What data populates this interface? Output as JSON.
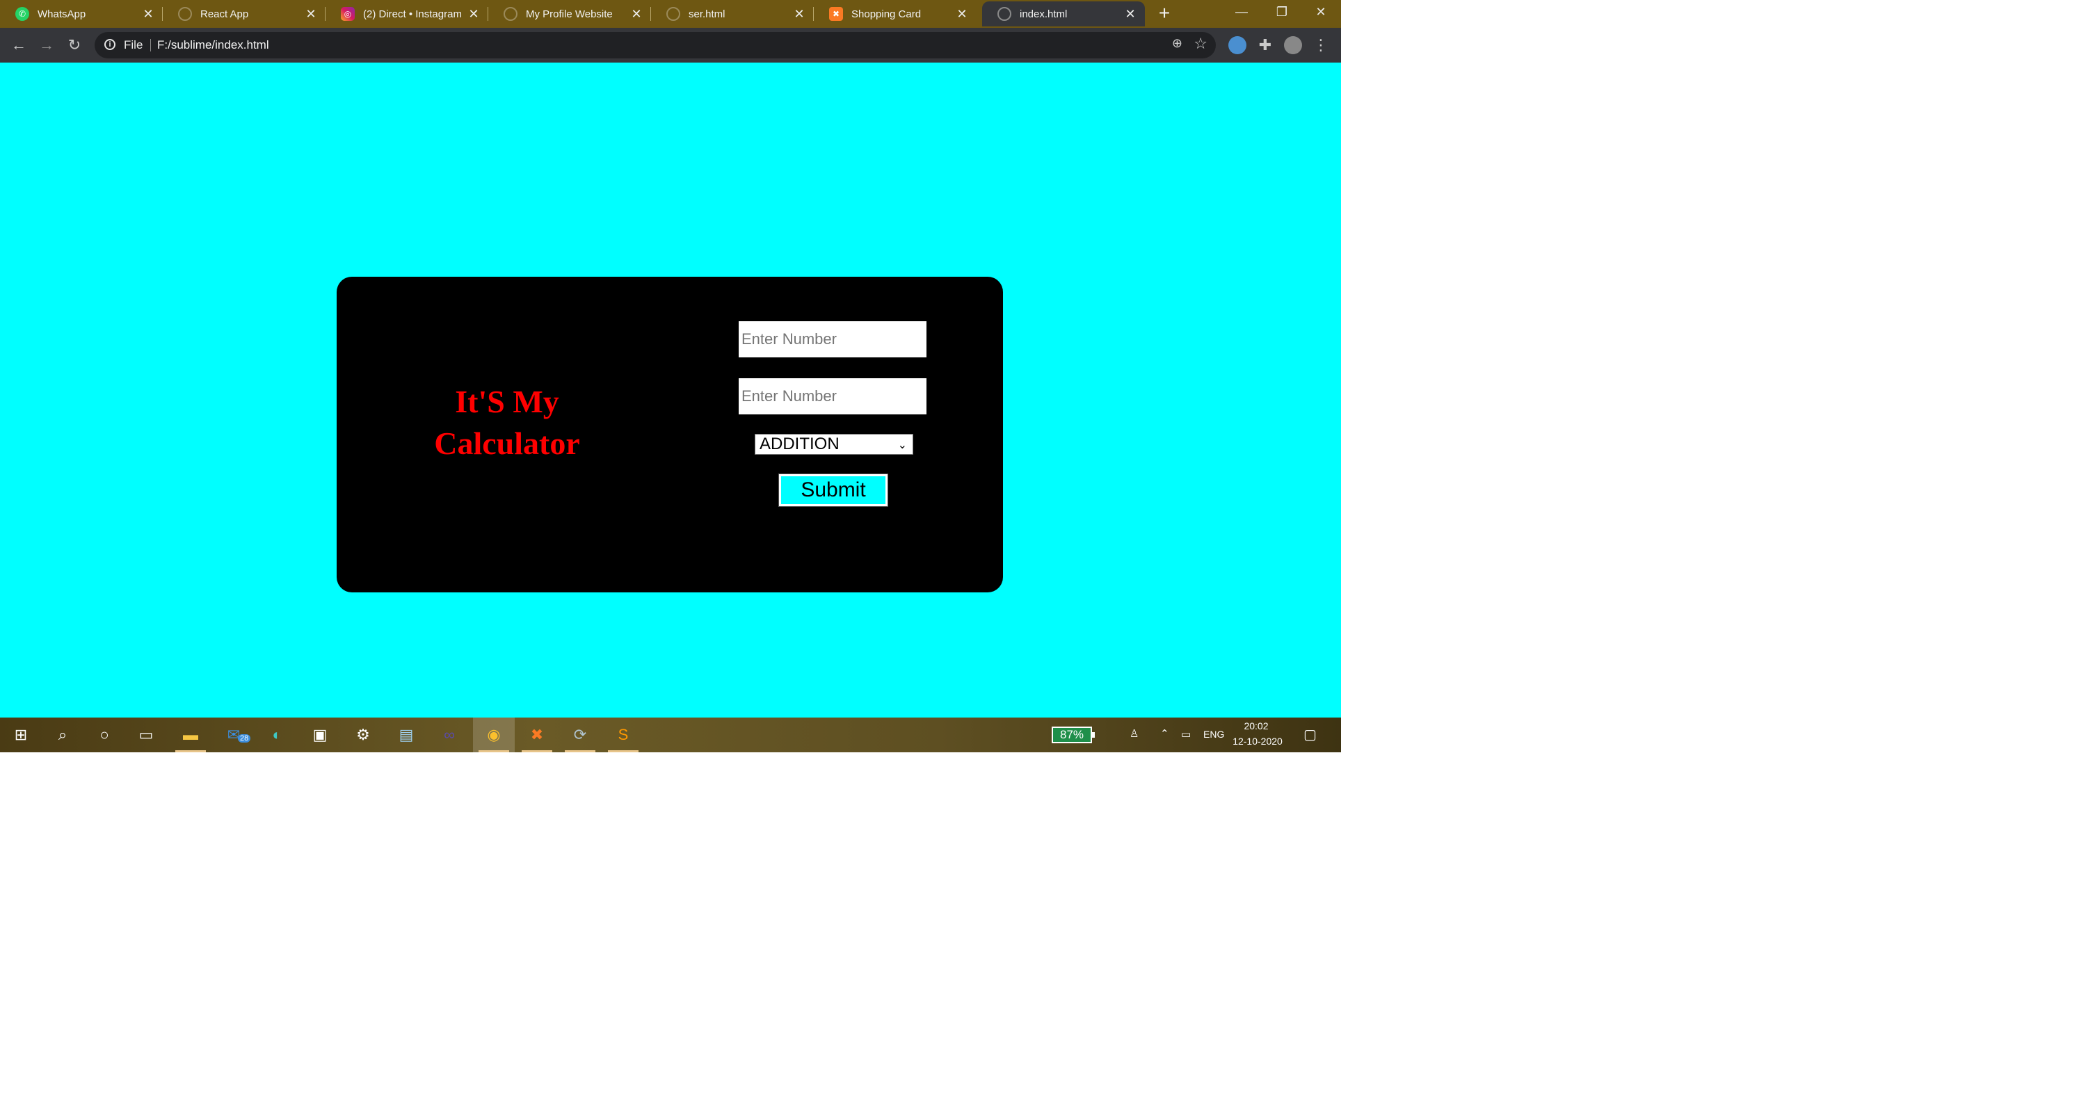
{
  "browser": {
    "tabs": [
      {
        "title": "WhatsApp",
        "icon": "whatsapp-icon",
        "active": false
      },
      {
        "title": "React App",
        "icon": "globe-icon",
        "active": false
      },
      {
        "title": "(2) Direct • Instagram",
        "icon": "instagram-icon",
        "active": false
      },
      {
        "title": "My Profile Website",
        "icon": "globe-icon",
        "active": false
      },
      {
        "title": "ser.html",
        "icon": "globe-icon",
        "active": false
      },
      {
        "title": "Shopping Card",
        "icon": "xampp-icon",
        "active": false
      },
      {
        "title": "index.html",
        "icon": "globe-icon",
        "active": true
      }
    ],
    "address_bar": {
      "scheme_label": "File",
      "url": "F:/sublime/index.html"
    }
  },
  "page": {
    "background_color": "#00ffff",
    "card_color": "#000000",
    "title_line1": "It'S My",
    "title_line2": "Calculator",
    "title_color": "#ff0000",
    "input1": {
      "placeholder": "Enter Number",
      "value": ""
    },
    "input2": {
      "placeholder": "Enter Number",
      "value": ""
    },
    "operation": {
      "selected": "ADDITION"
    },
    "submit_label": "Submit"
  },
  "taskbar": {
    "mail_badge": "28",
    "battery_percent": "87%",
    "language": "ENG",
    "time": "20:02",
    "date": "12-10-2020"
  }
}
